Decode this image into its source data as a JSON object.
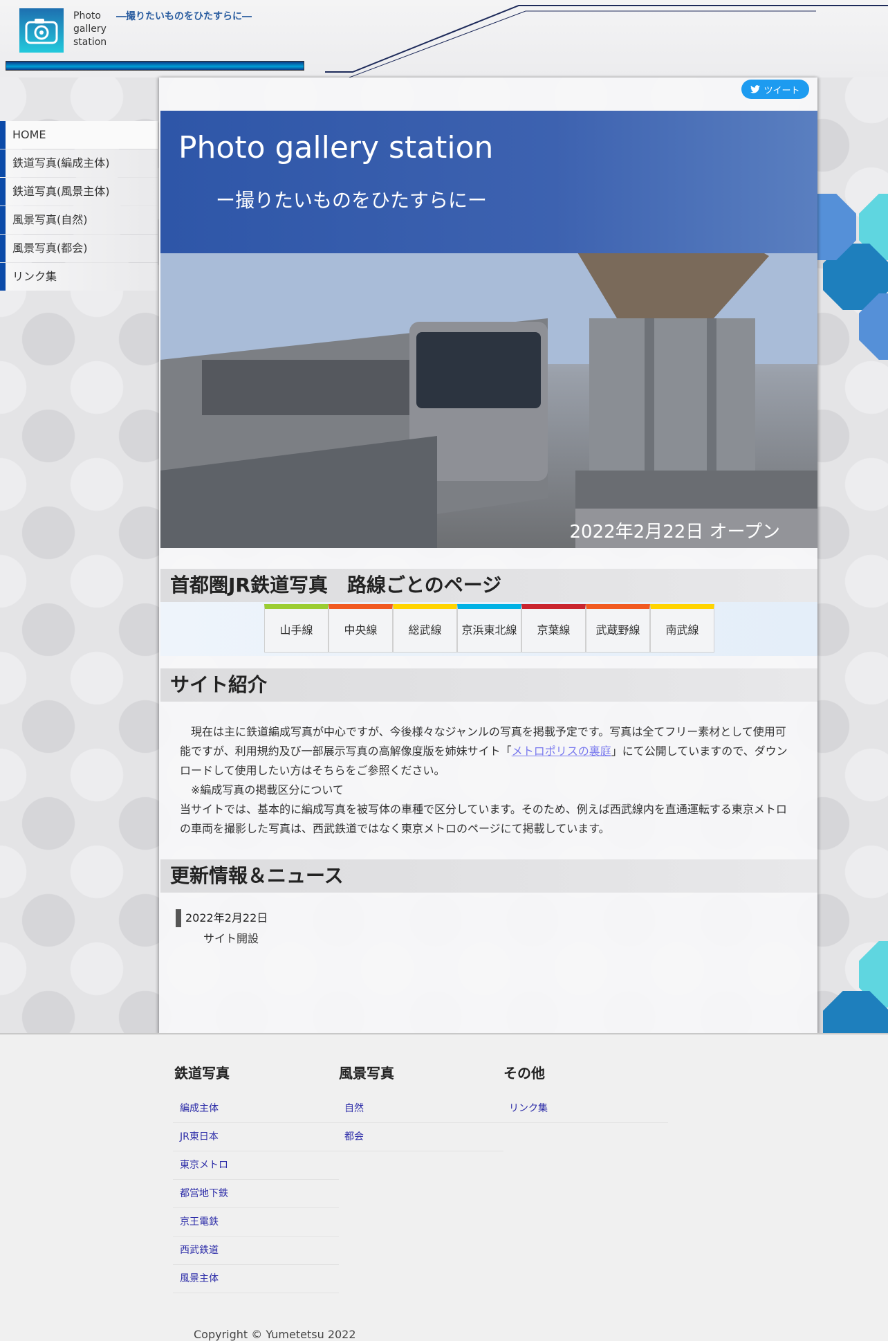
{
  "site": {
    "logo_text": "Photo gallery station",
    "tagline": "―撮りたいものをひたすらに―"
  },
  "nav": {
    "items": [
      {
        "label": "HOME"
      },
      {
        "label": "鉄道写真(編成主体)"
      },
      {
        "label": "鉄道写真(風景主体)"
      },
      {
        "label": "風景写真(自然)"
      },
      {
        "label": "風景写真(都会)"
      },
      {
        "label": "リンク集"
      }
    ]
  },
  "tweet": {
    "label": "ツイート"
  },
  "hero": {
    "title": "Photo gallery station",
    "subtitle": "ー撮りたいものをひたすらにー",
    "date": "2022年2月22日 オープン"
  },
  "lines_section": {
    "title": "首都圏JR鉄道写真　路線ごとのページ",
    "tabs": [
      {
        "label": "山手線",
        "color": "#9acd32"
      },
      {
        "label": "中央線",
        "color": "#f15a22"
      },
      {
        "label": "総武線",
        "color": "#ffd400"
      },
      {
        "label": "京浜東北線",
        "color": "#00b2e5"
      },
      {
        "label": "京葉線",
        "color": "#c9252f"
      },
      {
        "label": "武蔵野線",
        "color": "#f15a22"
      },
      {
        "label": "南武線",
        "color": "#ffd400"
      }
    ]
  },
  "intro_section": {
    "title": "サイト紹介",
    "p1_before": "現在は主に鉄道編成写真が中心ですが、今後様々なジャンルの写真を掲載予定です。写真は全てフリー素材として使用可能ですが、利用規約及び一部展示写真の高解像度版を姉妹サイト「",
    "p1_link": "メトロポリスの裏庭",
    "p1_after": "」にて公開していますので、ダウンロードして使用したい方はそちらをご参照ください。",
    "p2": "※編成写真の掲載区分について",
    "p3": "当サイトでは、基本的に編成写真を被写体の車種で区分しています。そのため、例えば西武線内を直通運転する東京メトロの車両を撮影した写真は、西武鉄道ではなく東京メトロのページにて掲載しています。"
  },
  "news_section": {
    "title": "更新情報＆ニュース",
    "items": [
      {
        "date": "2022年2月22日",
        "text": "サイト開設"
      }
    ]
  },
  "footer": {
    "columns": [
      {
        "title": "鉄道写真",
        "links": [
          "編成主体",
          "JR東日本",
          "東京メトロ",
          "都営地下鉄",
          "京王電鉄",
          "西武鉄道",
          "風景主体"
        ]
      },
      {
        "title": "風景写真",
        "links": [
          "自然",
          "都会"
        ]
      },
      {
        "title": "その他",
        "links": [
          "リンク集"
        ]
      }
    ],
    "copyright": "Copyright © Yumetetsu 2022"
  },
  "colors": {
    "accent": "#0b4aa8",
    "tweet": "#1d9bf0",
    "link": "#2c2ca8"
  }
}
